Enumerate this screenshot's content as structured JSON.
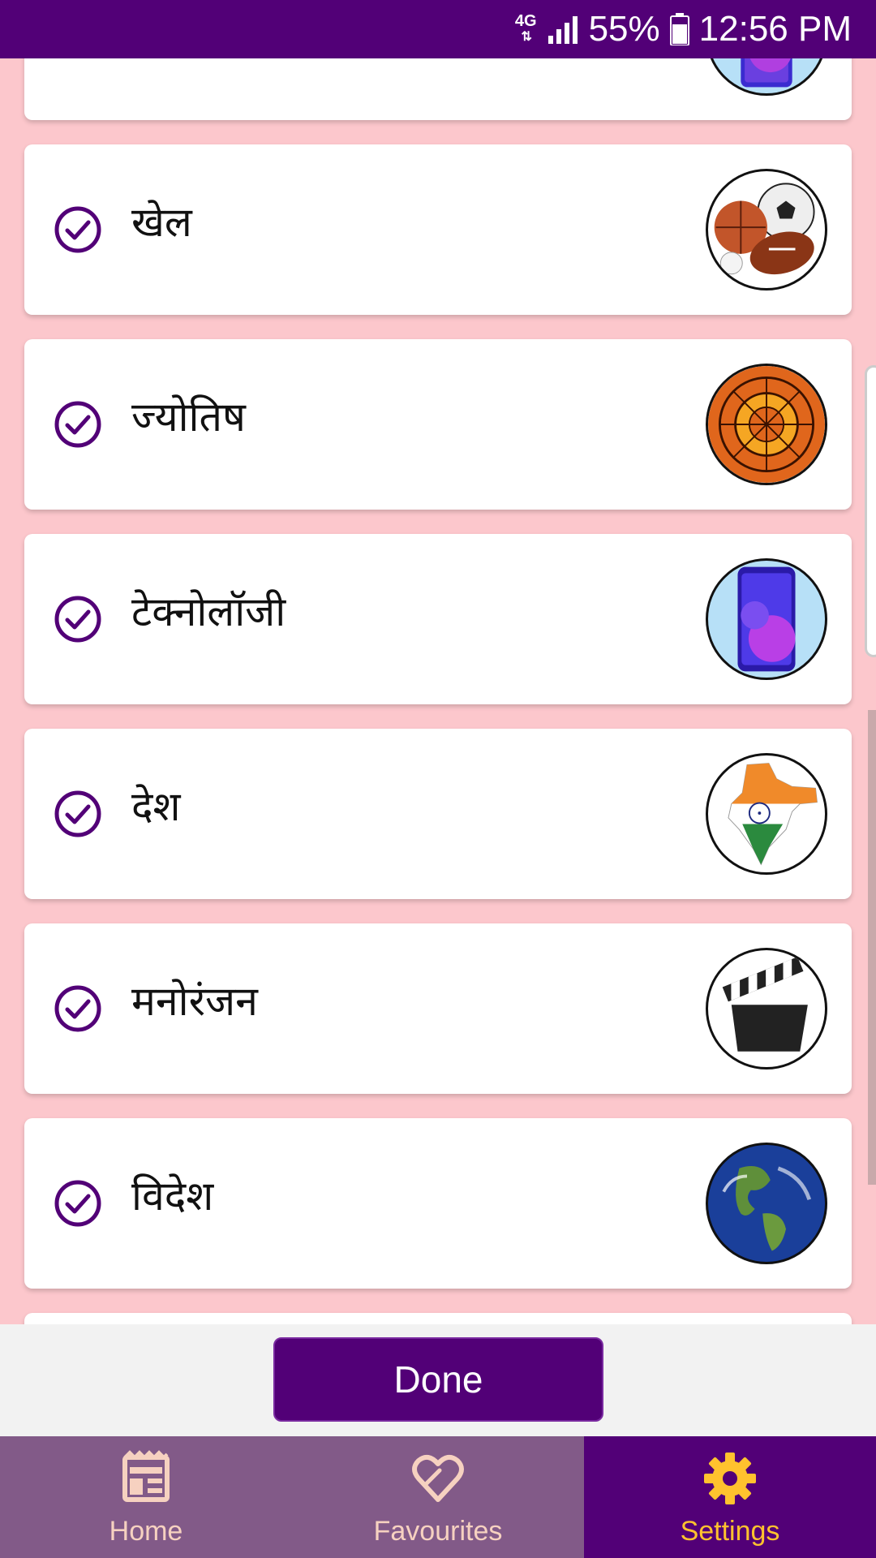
{
  "status_bar": {
    "network": "4G",
    "battery_percent": "55%",
    "time": "12:56 PM"
  },
  "categories": [
    {
      "label": "",
      "icon": "smartphone-icon",
      "selected": true
    },
    {
      "label": "खेल",
      "icon": "sports-balls-icon",
      "selected": true
    },
    {
      "label": "ज्योतिष",
      "icon": "zodiac-wheel-icon",
      "selected": true
    },
    {
      "label": "टेक्नोलॉजी",
      "icon": "smartphone-icon",
      "selected": true
    },
    {
      "label": "देश",
      "icon": "india-map-icon",
      "selected": true
    },
    {
      "label": "मनोरंजन",
      "icon": "clapperboard-icon",
      "selected": true
    },
    {
      "label": "विदेश",
      "icon": "globe-icon",
      "selected": true
    },
    {
      "label": "",
      "icon": "",
      "selected": true
    }
  ],
  "done_button": {
    "label": "Done"
  },
  "bottom_nav": {
    "items": [
      {
        "label": "Home",
        "icon": "newspaper-icon",
        "active": false
      },
      {
        "label": "Favourites",
        "icon": "heart-icon",
        "active": false
      },
      {
        "label": "Settings",
        "icon": "gear-icon",
        "active": true
      }
    ]
  },
  "colors": {
    "primary": "#520077",
    "background": "#fcc7cc",
    "nav_inactive": "#825a88",
    "nav_active_text": "#ffc22e",
    "nav_inactive_text": "#f6d1c0"
  }
}
